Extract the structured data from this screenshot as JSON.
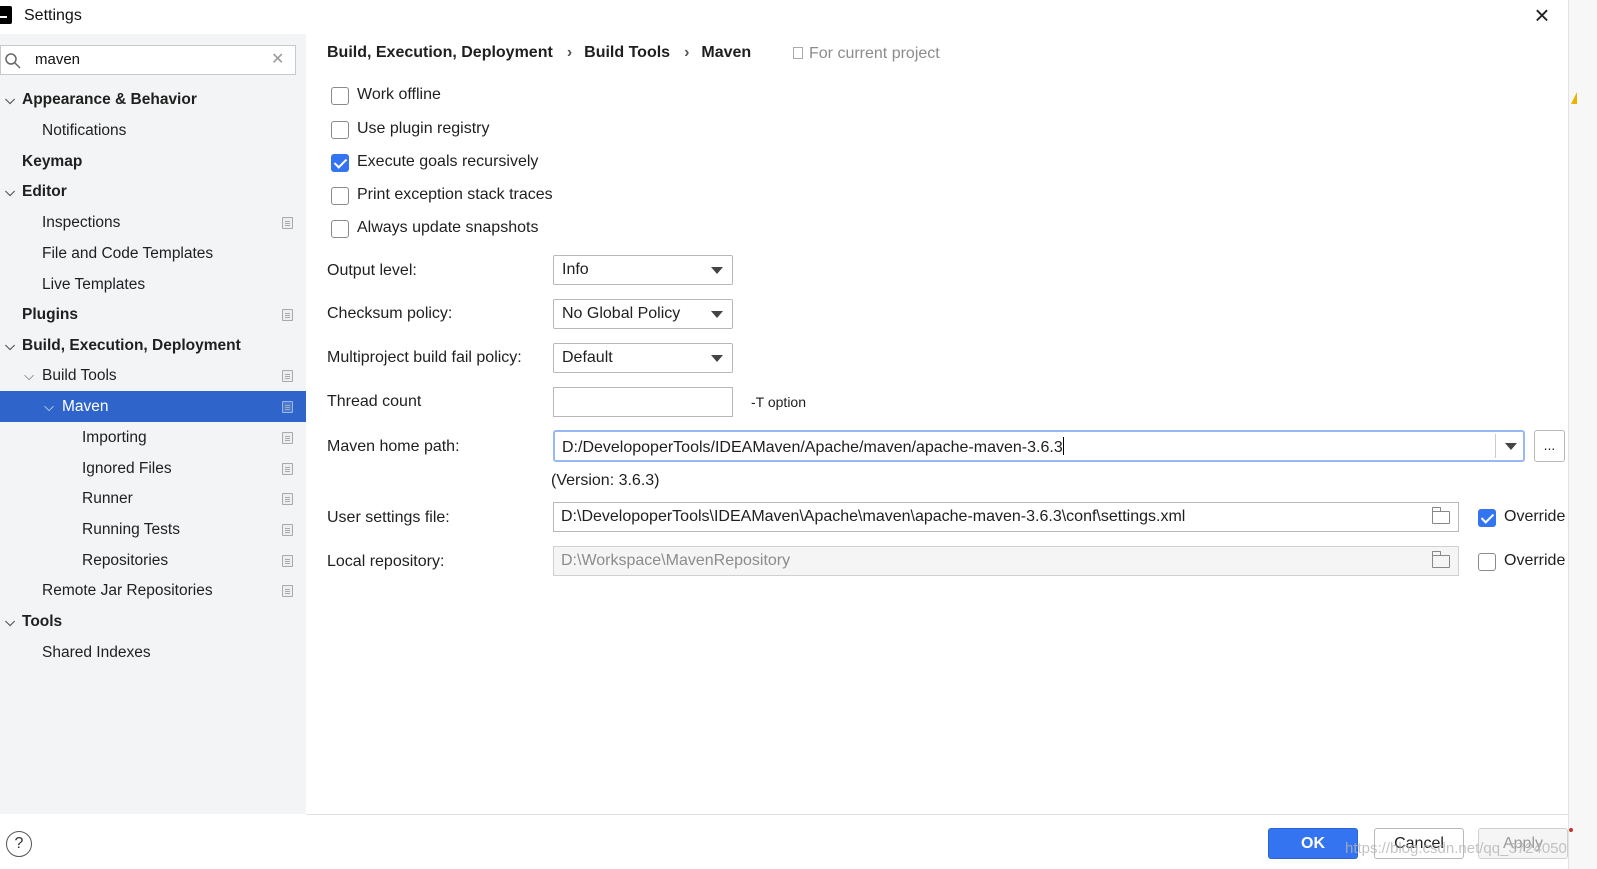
{
  "window": {
    "title": "Settings"
  },
  "icons": {
    "app": "intellij-logo-icon",
    "close": "close-icon",
    "search": "search-icon",
    "clear": "clear-icon",
    "help": "help-icon",
    "folder": "folder-icon",
    "project_scope": "project-scope-icon"
  },
  "search": {
    "value": "maven",
    "close_glyph": "×",
    "clear_glyph": "✕"
  },
  "sidebar": {
    "items": [
      {
        "label": "Appearance & Behavior",
        "bold": true,
        "expanded": true
      },
      {
        "label": "Notifications"
      },
      {
        "label": "Keymap",
        "bold": true
      },
      {
        "label": "Editor",
        "bold": true,
        "expanded": true
      },
      {
        "label": "Inspections",
        "project": true
      },
      {
        "label": "File and Code Templates"
      },
      {
        "label": "Live Templates"
      },
      {
        "label": "Plugins",
        "bold": true,
        "project": true
      },
      {
        "label": "Build, Execution, Deployment",
        "bold": true,
        "expanded": true
      },
      {
        "label": "Build Tools",
        "project": true,
        "expanded": true
      },
      {
        "label": "Maven",
        "project": true,
        "expanded": true,
        "selected": true
      },
      {
        "label": "Importing",
        "project": true
      },
      {
        "label": "Ignored Files",
        "project": true
      },
      {
        "label": "Runner",
        "project": true
      },
      {
        "label": "Running Tests",
        "project": true
      },
      {
        "label": "Repositories",
        "project": true
      },
      {
        "label": "Remote Jar Repositories",
        "project": true
      },
      {
        "label": "Tools",
        "bold": true,
        "expanded": true
      },
      {
        "label": "Shared Indexes"
      }
    ]
  },
  "breadcrumb": {
    "parts": [
      "Build, Execution, Deployment",
      "Build Tools",
      "Maven"
    ],
    "separator": "›",
    "scope": "For current project"
  },
  "options": {
    "work_offline": {
      "label": "Work offline",
      "checked": false
    },
    "use_plugin_registry": {
      "label": "Use plugin registry",
      "checked": false
    },
    "execute_goals_recursively": {
      "label": "Execute goals recursively",
      "checked": true
    },
    "print_exception_stack_traces": {
      "label": "Print exception stack traces",
      "checked": false
    },
    "always_update_snapshots": {
      "label": "Always update snapshots",
      "checked": false
    }
  },
  "fields": {
    "output_level": {
      "label": "Output level:",
      "value": "Info"
    },
    "checksum_policy": {
      "label": "Checksum policy:",
      "value": "No Global Policy"
    },
    "multiproject_fail_policy": {
      "label": "Multiproject build fail policy:",
      "value": "Default"
    },
    "thread_count": {
      "label": "Thread count",
      "value": "",
      "hint": "-T option"
    },
    "maven_home": {
      "label": "Maven home path:",
      "value": "D:/DevelopoperTools/IDEAMaven/Apache/maven/apache-maven-3.6.3",
      "version": "(Version: 3.6.3)",
      "browse": "..."
    },
    "user_settings": {
      "label": "User settings file:",
      "value": "D:\\DevelopoperTools\\IDEAMaven\\Apache\\maven\\apache-maven-3.6.3\\conf\\settings.xml",
      "override_label": "Override",
      "override": true
    },
    "local_repo": {
      "label": "Local repository:",
      "value": "D:\\Workspace\\MavenRepository",
      "override_label": "Override",
      "override": false
    }
  },
  "buttons": {
    "ok": "OK",
    "cancel": "Cancel",
    "apply": "Apply",
    "help": "?"
  },
  "watermark": "https://blog.csdn.net/qq_37240503"
}
